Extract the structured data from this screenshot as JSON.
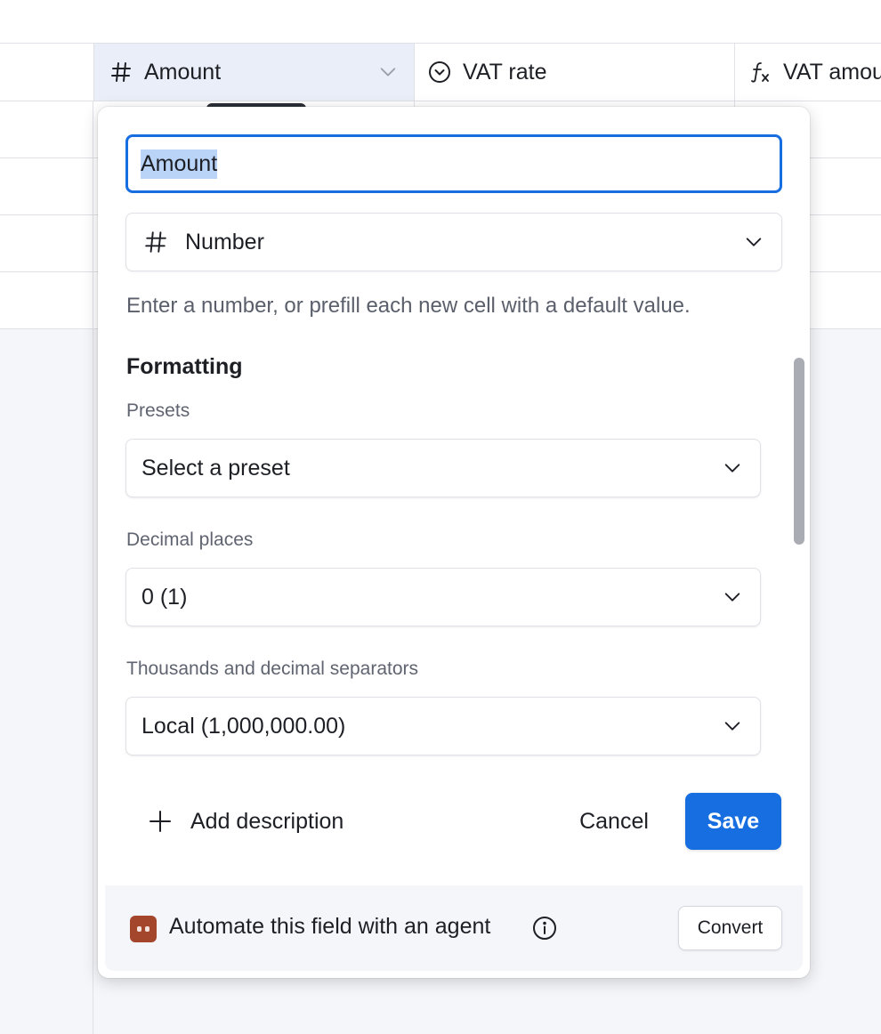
{
  "grid": {
    "columns": [
      {
        "label": "Amount",
        "icon": "hash-icon"
      },
      {
        "label": "VAT rate",
        "icon": "single-select-icon"
      },
      {
        "label": "VAT amou",
        "icon": "formula-icon"
      }
    ]
  },
  "field_editor": {
    "name_value": "Amount",
    "type": {
      "label": "Number",
      "icon": "hash-icon"
    },
    "helper_text": "Enter a number, or prefill each new cell with a default value.",
    "formatting_title": "Formatting",
    "presets": {
      "label": "Presets",
      "value": "Select a preset"
    },
    "decimal_places": {
      "label": "Decimal places",
      "value": "0 (1)"
    },
    "separators": {
      "label": "Thousands and decimal separators",
      "value": "Local (1,000,000.00)"
    },
    "add_description_label": "Add description",
    "cancel_label": "Cancel",
    "save_label": "Save",
    "agent": {
      "text": "Automate this field with an agent",
      "convert_label": "Convert"
    }
  },
  "colors": {
    "accent": "#166ee1",
    "selected_header": "#e9eef8",
    "agent_icon": "#a3462c"
  }
}
